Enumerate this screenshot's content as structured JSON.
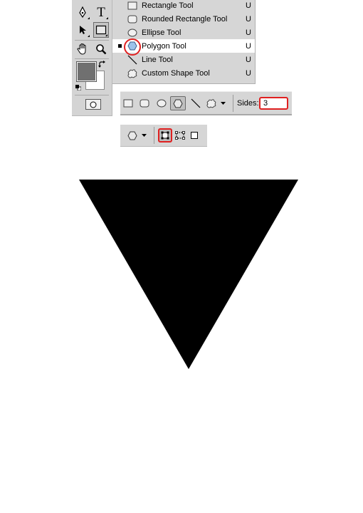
{
  "toolbox": {
    "tools": [
      "pen-icon",
      "type-icon",
      "path-selection-icon",
      "shape-icon",
      "hand-icon",
      "zoom-icon"
    ],
    "foreground_color": "#707070",
    "background_color": "#ffffff"
  },
  "type_tool_glyph": "T",
  "flyout_menu": {
    "items": [
      {
        "label": "Rectangle Tool",
        "shortcut": "U",
        "icon": "rectangle-icon",
        "selected": false
      },
      {
        "label": "Rounded Rectangle Tool",
        "shortcut": "U",
        "icon": "rounded-rectangle-icon",
        "selected": false
      },
      {
        "label": "Ellipse Tool",
        "shortcut": "U",
        "icon": "ellipse-icon",
        "selected": false
      },
      {
        "label": "Polygon Tool",
        "shortcut": "U",
        "icon": "polygon-icon",
        "selected": true
      },
      {
        "label": "Line Tool",
        "shortcut": "U",
        "icon": "line-icon",
        "selected": false
      },
      {
        "label": "Custom Shape Tool",
        "shortcut": "U",
        "icon": "custom-shape-icon",
        "selected": false
      }
    ]
  },
  "options_bar": {
    "shape_buttons": [
      "rectangle-icon",
      "rounded-rectangle-icon",
      "ellipse-icon",
      "polygon-icon",
      "line-icon",
      "custom-shape-icon"
    ],
    "active_shape": "polygon-icon",
    "sides_label": "Sides:",
    "sides_value": "3"
  },
  "mode_bar": {
    "modes": [
      "shape-layers-icon",
      "paths-icon",
      "fill-pixels-icon"
    ],
    "active_mode": "shape-layers-icon"
  },
  "canvas": {
    "shape": "inverted triangle",
    "fill_color": "#000000"
  },
  "highlight_color": "#e02020"
}
